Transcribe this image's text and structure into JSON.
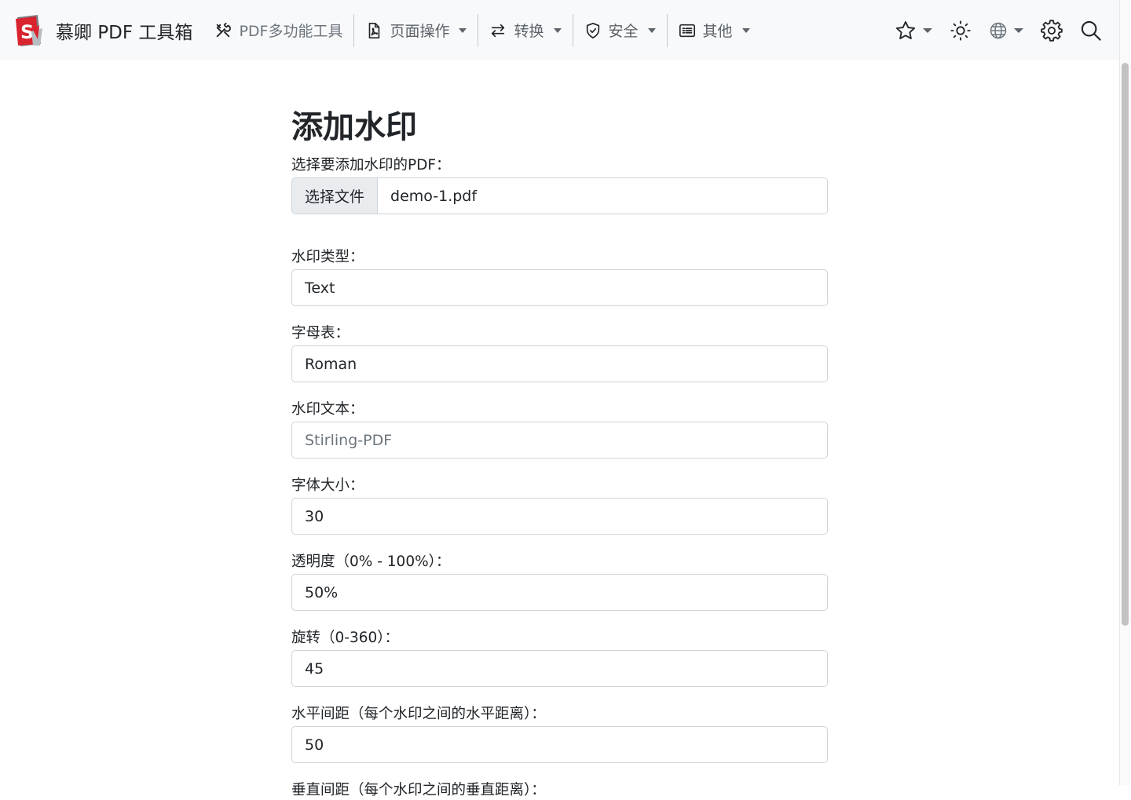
{
  "brand": {
    "name": "慕卿 PDF 工具箱"
  },
  "nav": {
    "multi_tool": "PDF多功能工具",
    "page_ops": "页面操作",
    "convert": "转换",
    "security": "安全",
    "other": "其他"
  },
  "form": {
    "title": "添加水印",
    "file_label": "选择要添加水印的PDF：",
    "file_button": "选择文件",
    "file_name": "demo-1.pdf",
    "type_label": "水印类型：",
    "type_value": "Text",
    "alphabet_label": "字母表：",
    "alphabet_value": "Roman",
    "text_label": "水印文本：",
    "text_placeholder": "Stirling-PDF",
    "font_size_label": "字体大小：",
    "font_size_value": "30",
    "opacity_label": "透明度（0% - 100%）：",
    "opacity_value": "50%",
    "rotation_label": "旋转（0-360）：",
    "rotation_value": "45",
    "width_spacer_label": "水平间距（每个水印之间的水平距离）：",
    "width_spacer_value": "50",
    "height_spacer_label": "垂直间距（每个水印之间的垂直距离）："
  },
  "colors": {
    "navbar_bg": "#f8f9fa",
    "logo_red": "#d9232e",
    "border": "#ced4da"
  }
}
